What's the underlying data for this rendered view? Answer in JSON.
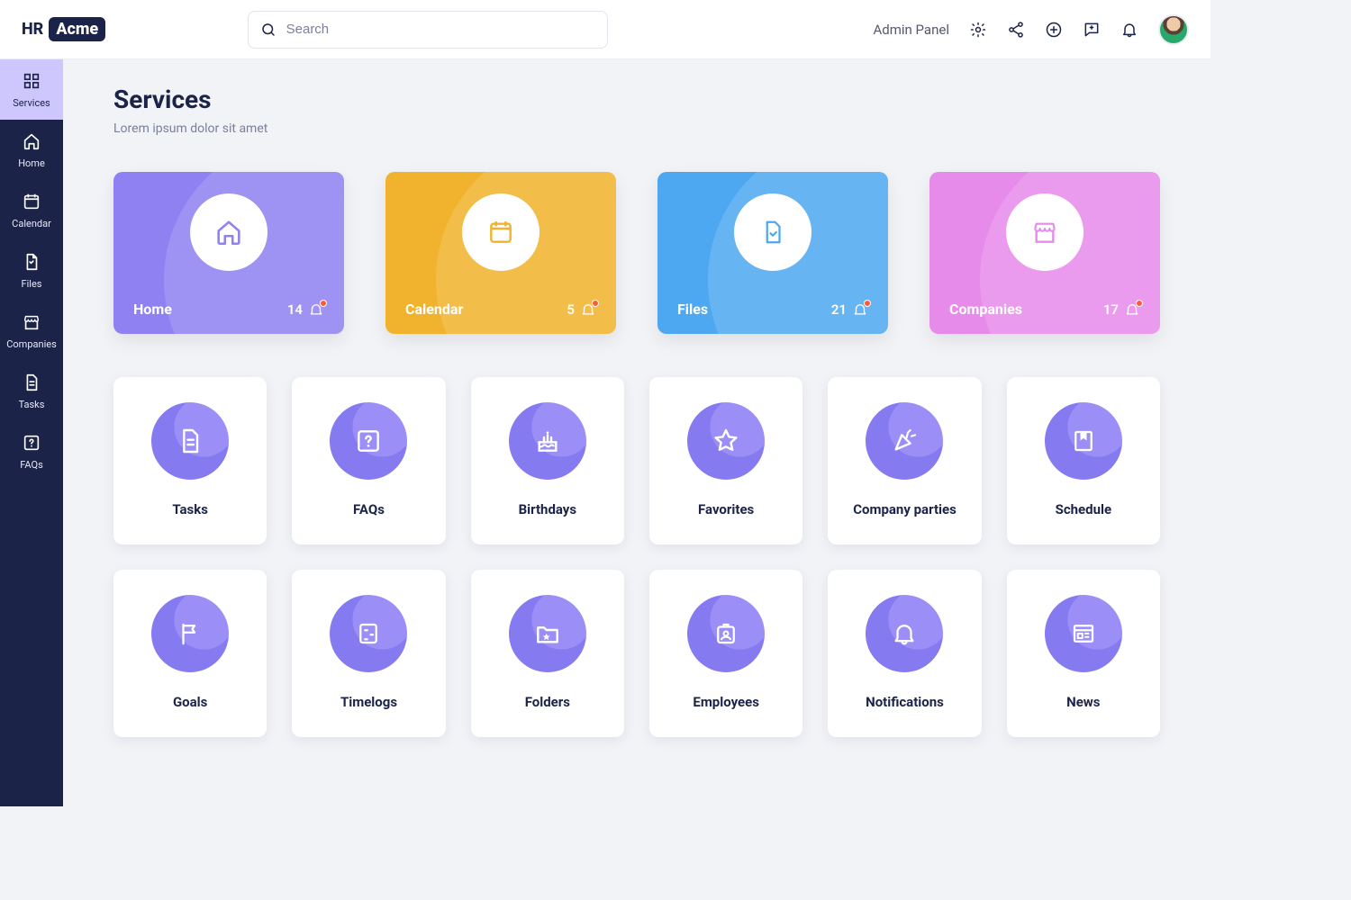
{
  "logo": {
    "prefix": "HR",
    "name": "Acme"
  },
  "search": {
    "placeholder": "Search"
  },
  "header": {
    "admin_label": "Admin Panel"
  },
  "sidebar": {
    "items": [
      {
        "label": "Services"
      },
      {
        "label": "Home"
      },
      {
        "label": "Calendar"
      },
      {
        "label": "Files"
      },
      {
        "label": "Companies"
      },
      {
        "label": "Tasks"
      },
      {
        "label": "FAQs"
      }
    ]
  },
  "page": {
    "title": "Services",
    "subtitle": "Lorem ipsum dolor sit amet"
  },
  "featured": [
    {
      "label": "Home",
      "count": "14"
    },
    {
      "label": "Calendar",
      "count": "5"
    },
    {
      "label": "Files",
      "count": "21"
    },
    {
      "label": "Companies",
      "count": "17"
    }
  ],
  "cards": [
    {
      "label": "Tasks"
    },
    {
      "label": "FAQs"
    },
    {
      "label": "Birthdays"
    },
    {
      "label": "Favorites"
    },
    {
      "label": "Company parties"
    },
    {
      "label": "Schedule"
    },
    {
      "label": "Goals"
    },
    {
      "label": "Timelogs"
    },
    {
      "label": "Folders"
    },
    {
      "label": "Employees"
    },
    {
      "label": "Notifications"
    },
    {
      "label": "News"
    }
  ]
}
